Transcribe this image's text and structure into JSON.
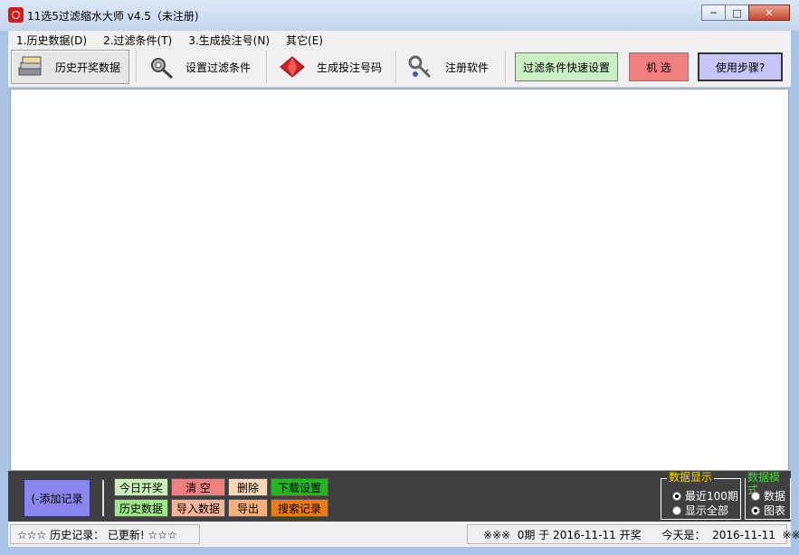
{
  "window": {
    "title": "11选5过滤缩水大师 v4.5（未注册)",
    "minimize": "─",
    "maximize": "□",
    "close": "✕"
  },
  "menu": [
    "1.历史数据(D)",
    "2.过滤条件(T)",
    "3.生成投注号(N)",
    "其它(E)"
  ],
  "toolbar": {
    "history": "历史开奖数据",
    "filter": "设置过滤条件",
    "generate": "生成投注号码",
    "register": "注册软件",
    "quick_filter": "过滤条件快速设置",
    "random": "机  选",
    "steps": "使用步骤?"
  },
  "bottom": {
    "add_record": "(-添加记录",
    "today_draw": "今日开奖",
    "clear": "清  空",
    "delete": "删除",
    "download_settings": "下载设置",
    "history_data": "历史数据",
    "import_data": "导入数据",
    "export": "导出",
    "search_records": "搜索记录",
    "display_title": "数据显示",
    "display_recent": "最近100期",
    "display_all": "显示全部",
    "mode_title": "数据模式",
    "mode_data": "数据",
    "mode_chart": "图表"
  },
  "status": {
    "left": "☆☆☆  历史记录：  已更新!   ☆☆☆",
    "right": "※※※  0期 于 2016-11-11 开奖      今天是：  2016-11-11  ※※※"
  },
  "colors": {
    "quick_filter_bg": "#c8f0c0",
    "random_bg": "#f08080",
    "steps_bg": "#c9c4f7",
    "add_record_bg": "#8b86ee",
    "today_bg": "#c8f0b8",
    "clear_bg": "#f08080",
    "delete_bg": "#f7d7b8",
    "download_bg": "#1fb81f",
    "history_bg": "#9ee68a",
    "import_bg": "#f7b49a",
    "export_bg": "#f7b07a",
    "search_bg": "#f07a12"
  }
}
